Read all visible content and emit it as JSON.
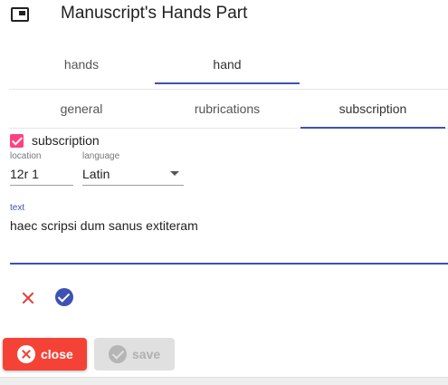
{
  "header": {
    "title": "Manuscript's Hands Part",
    "icon": "picture-in-picture-icon"
  },
  "tabs_outer": [
    {
      "label": "hands",
      "active": false
    },
    {
      "label": "hand",
      "active": true
    }
  ],
  "tabs_inner": [
    {
      "label": "general",
      "active": false
    },
    {
      "label": "rubrications",
      "active": false
    },
    {
      "label": "subscription",
      "active": true
    }
  ],
  "subscription": {
    "checkbox_label": "subscription",
    "checked": true,
    "location": {
      "label": "location",
      "value": "12r 1"
    },
    "language": {
      "label": "language",
      "value": "Latin"
    },
    "text": {
      "label": "text",
      "value": "haec scripsi dum sanus extiteram"
    }
  },
  "actions": {
    "discard_icon": "close-icon",
    "accept_icon": "check-circle-icon"
  },
  "buttons": {
    "close_label": "close",
    "save_label": "save"
  },
  "colors": {
    "accent": "#3f51b5",
    "checkbox": "#ff4081",
    "danger": "#f44336",
    "disabled": "#e0e0e0"
  }
}
